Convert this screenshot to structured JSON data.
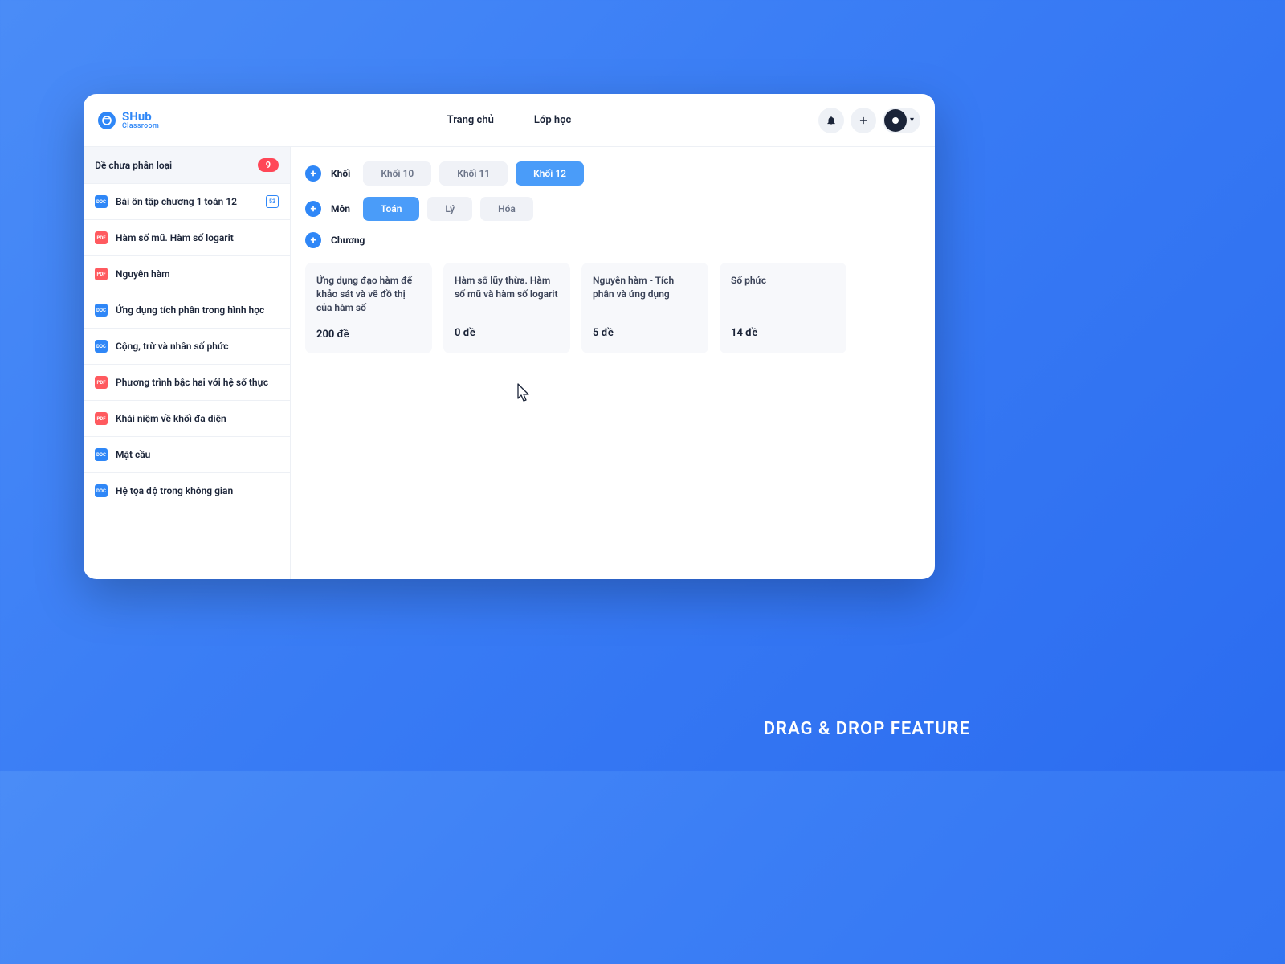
{
  "logo": {
    "name": "SHub",
    "sub": "Classroom"
  },
  "nav": {
    "home": "Trang chủ",
    "class": "Lớp học"
  },
  "sidebar": {
    "unsorted": {
      "label": "Đề chưa phân loại",
      "count": "9"
    },
    "items": [
      {
        "icon": "blue",
        "label": "Bài ôn tập chương 1 toán 12",
        "trail": "53"
      },
      {
        "icon": "red",
        "label": "Hàm số mũ. Hàm số logarit"
      },
      {
        "icon": "red",
        "label": "Nguyên hàm"
      },
      {
        "icon": "blue",
        "label": "Ứng dụng tích phân trong hình học"
      },
      {
        "icon": "blue",
        "label": "Cộng, trừ và nhân số phức"
      },
      {
        "icon": "red",
        "label": "Phương trình bậc hai với hệ số thực"
      },
      {
        "icon": "red",
        "label": "Khái niệm về khối đa diện"
      },
      {
        "icon": "blue",
        "label": "Mặt cầu"
      },
      {
        "icon": "blue",
        "label": "Hệ tọa độ trong không gian"
      }
    ]
  },
  "filters": {
    "grade": {
      "label": "Khối",
      "options": [
        "Khối 10",
        "Khối 11",
        "Khối 12"
      ],
      "active": 2
    },
    "subject": {
      "label": "Môn",
      "options": [
        "Toán",
        "Lý",
        "Hóa"
      ],
      "active": 0
    },
    "chapter": {
      "label": "Chương"
    }
  },
  "chapters": [
    {
      "title": "Ứng dụng đạo hàm để khảo sát và vẽ đồ thị của hàm số",
      "count": "200 đề"
    },
    {
      "title": "Hàm số lũy thừa. Hàm số mũ và hàm số logarit",
      "count": "0 đề"
    },
    {
      "title": "Nguyên hàm - Tích phân và ứng dụng",
      "count": "5 đề"
    },
    {
      "title": "Số phức",
      "count": "14 đề"
    }
  ],
  "footer": "DRAG & DROP FEATURE"
}
